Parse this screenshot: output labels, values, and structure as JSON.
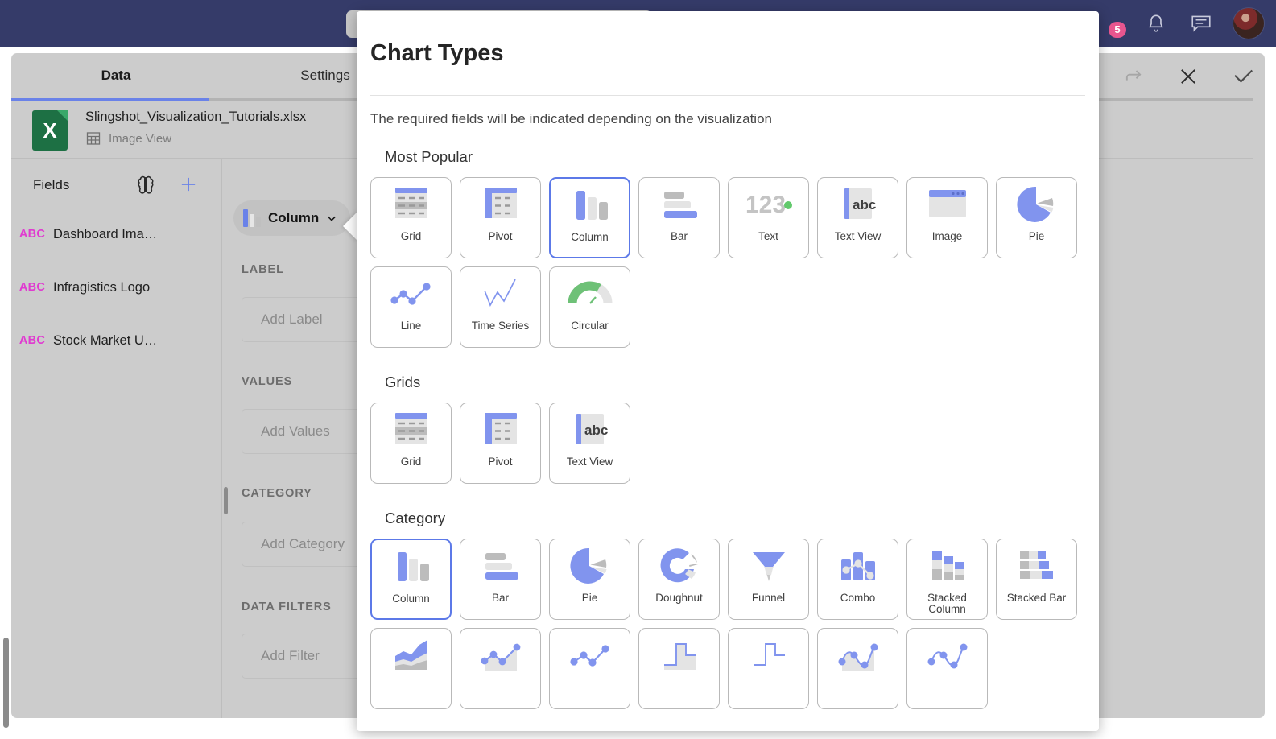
{
  "colors": {
    "nav_bg": "#353b69",
    "accent_blue": "#6a82e8",
    "icon_blue": "#8194ee",
    "icon_grey": "#c0c0c0",
    "icon_grey_dark": "#b4b4b4",
    "green": "#6ec177",
    "badge_pink": "#e8568f",
    "field_type": "#e03ad0",
    "excel_green": "#1d7044"
  },
  "topnav": {
    "notifications_badge": "5",
    "icons": [
      {
        "name": "notifications-badge",
        "label": "5"
      },
      {
        "name": "bell-icon",
        "label": ""
      },
      {
        "name": "chat-icon",
        "label": ""
      },
      {
        "name": "avatar",
        "label": ""
      }
    ]
  },
  "search": {
    "placeholder": ""
  },
  "sidebar": {
    "tabs": [
      {
        "label": "Data",
        "active": true
      },
      {
        "label": "Settings",
        "active": false
      }
    ],
    "file": {
      "name": "Slingshot_Visualization_Tutorials.xlsx",
      "view": "Image View",
      "icon_letter": "X"
    },
    "fields": {
      "title": "Fields",
      "items": [
        {
          "type": "ABC",
          "name": "Dashboard Ima…"
        },
        {
          "type": "ABC",
          "name": "Infragistics Logo"
        },
        {
          "type": "ABC",
          "name": "Stock Market U…"
        }
      ]
    }
  },
  "viz_config": {
    "chip_label": "Column",
    "sections": [
      {
        "label": "LABEL",
        "placeholder": "Add Label"
      },
      {
        "label": "VALUES",
        "placeholder": "Add Values"
      },
      {
        "label": "CATEGORY",
        "placeholder": "Add Category"
      },
      {
        "label": "DATA FILTERS",
        "placeholder": "Add Filter"
      }
    ]
  },
  "panel_tools": [
    {
      "name": "redo-icon"
    },
    {
      "name": "close-icon"
    },
    {
      "name": "confirm-check-icon"
    }
  ],
  "modal": {
    "title": "Chart Types",
    "subtitle": "The required fields will be indicated depending on the visualization",
    "groups": [
      {
        "title": "Most Popular",
        "cards": [
          {
            "label": "Grid",
            "icon": "grid-icon",
            "selected": false
          },
          {
            "label": "Pivot",
            "icon": "pivot-icon",
            "selected": false
          },
          {
            "label": "Column",
            "icon": "column-chart-icon",
            "selected": true
          },
          {
            "label": "Bar",
            "icon": "bar-chart-icon",
            "selected": false
          },
          {
            "label": "Text",
            "icon": "text-number-icon",
            "selected": false
          },
          {
            "label": "Text View",
            "icon": "text-view-icon",
            "selected": false
          },
          {
            "label": "Image",
            "icon": "image-icon",
            "selected": false
          },
          {
            "label": "Pie",
            "icon": "pie-chart-icon",
            "selected": false
          },
          {
            "label": "Line",
            "icon": "line-chart-icon",
            "selected": false
          },
          {
            "label": "Time Series",
            "icon": "time-series-icon",
            "selected": false
          },
          {
            "label": "Circular",
            "icon": "circular-gauge-icon",
            "selected": false
          }
        ]
      },
      {
        "title": "Grids",
        "cards": [
          {
            "label": "Grid",
            "icon": "grid-icon",
            "selected": false
          },
          {
            "label": "Pivot",
            "icon": "pivot-icon",
            "selected": false
          },
          {
            "label": "Text View",
            "icon": "text-view-icon",
            "selected": false
          }
        ]
      },
      {
        "title": "Category",
        "cards": [
          {
            "label": "Column",
            "icon": "column-chart-icon",
            "selected": true
          },
          {
            "label": "Bar",
            "icon": "bar-chart-icon",
            "selected": false
          },
          {
            "label": "Pie",
            "icon": "pie-chart-icon",
            "selected": false
          },
          {
            "label": "Doughnut",
            "icon": "doughnut-chart-icon",
            "selected": false
          },
          {
            "label": "Funnel",
            "icon": "funnel-chart-icon",
            "selected": false
          },
          {
            "label": "Combo",
            "icon": "combo-chart-icon",
            "selected": false
          },
          {
            "label": "Stacked Column",
            "icon": "stacked-column-icon",
            "selected": false
          },
          {
            "label": "Stacked Bar",
            "icon": "stacked-bar-icon",
            "selected": false
          },
          {
            "label": "",
            "icon": "area-chart-icon",
            "selected": false
          },
          {
            "label": "",
            "icon": "line-area-chart-icon",
            "selected": false
          },
          {
            "label": "",
            "icon": "scatter-line-icon",
            "selected": false
          },
          {
            "label": "",
            "icon": "step-area-icon",
            "selected": false
          },
          {
            "label": "",
            "icon": "step-line-icon",
            "selected": false
          },
          {
            "label": "",
            "icon": "spline-area-icon",
            "selected": false
          },
          {
            "label": "",
            "icon": "spline-icon",
            "selected": false
          }
        ]
      }
    ]
  }
}
